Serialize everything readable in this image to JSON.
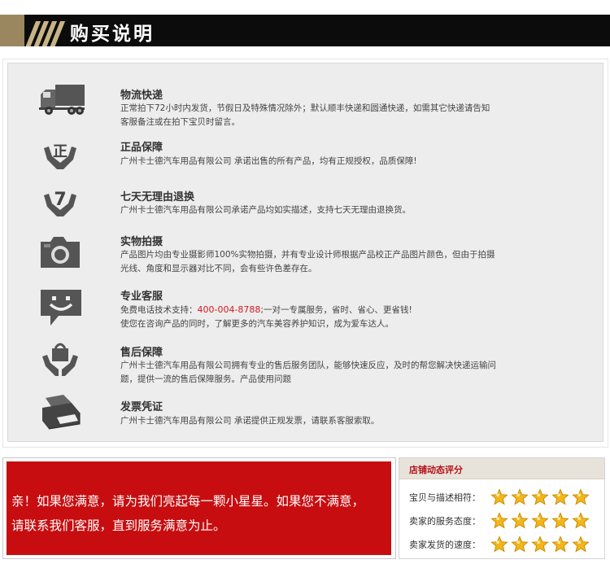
{
  "header": {
    "title": "购买说明"
  },
  "items": [
    {
      "icon": "truck-icon",
      "title": "物流快递",
      "desc": [
        "正常拍下72小时内发货，节假日及特殊情况除外；默认顺丰快递和圆通快递，如需其它快递请告知",
        "客服备注或在拍下宝贝时留言。"
      ]
    },
    {
      "icon": "genuine-hands-icon",
      "title": "正品保障",
      "desc": [
        "广州卡士德汽车用品有限公司 承诺出售的所有产品，均有正规授权，品质保障!"
      ]
    },
    {
      "icon": "seven-days-hands-icon",
      "title": "七天无理由退换",
      "desc": [
        "广州卡士德汽车用品有限公司承诺产品均如实描述，支持七天无理由退换货。"
      ]
    },
    {
      "icon": "camera-icon",
      "title": "实物拍摄",
      "desc": [
        "产品图片均由专业摄影师100%实物拍摄，并有专业设计师根据产品校正产品图片颜色，但由于拍摄",
        "光线、角度和显示器对比不同，会有些许色差存在。"
      ]
    },
    {
      "icon": "chat-smile-icon",
      "title": "专业客服",
      "desc_prefix": "免费电话技术支持：",
      "phone": "400-004-8788",
      "desc_suffix": ";一对一专属服务，省时、省心、更省钱!",
      "desc": [
        "使您在咨询产品的同时，了解更多的汽车美容养护知识，成为爱车达人。"
      ]
    },
    {
      "icon": "service-bag-icon",
      "title": "售后保障",
      "desc": [
        "广州卡士德汽车用品有限公司拥有专业的售后服务团队，能够快速反应，及时的帮您解决快递运输问",
        "题，提供一流的售后保障服务。产品使用问题"
      ]
    },
    {
      "icon": "printer-icon",
      "title": "发票凭证",
      "desc": [
        "广州卡士德汽车用品有限公司 承诺提供正规发票，请联系客服索取。"
      ]
    }
  ],
  "promo": {
    "lines": [
      "亲！如果您满意，请为我们亮起每一颗小星星。如果您不满意，",
      "请联系我们客服，直到服务满意为止。"
    ]
  },
  "rating": {
    "title": "店铺动态评分",
    "rows": [
      {
        "label": "宝贝与描述相符：",
        "stars": 5
      },
      {
        "label": "卖家的服务态度：",
        "stars": 5
      },
      {
        "label": "卖家发货的速度：",
        "stars": 5
      }
    ],
    "star_color": "#f2b61b"
  },
  "colors": {
    "accent_red": "#c70d10",
    "header_bg": "#0c0c0c",
    "gold": "#9a8760",
    "phone": "#d8181f"
  }
}
